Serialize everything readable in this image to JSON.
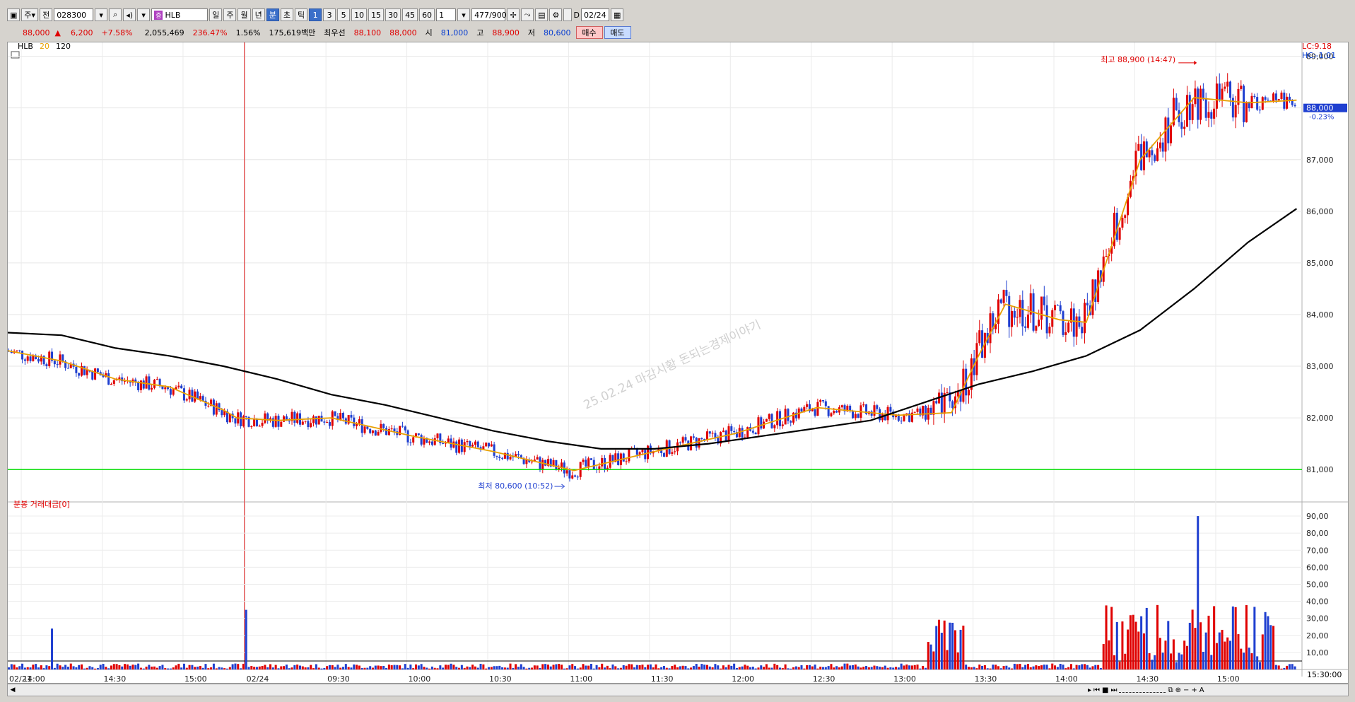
{
  "toolbar": {
    "type_label": "주",
    "ref_label": "전",
    "code": "028300",
    "stock_badge": "증",
    "stock_name": "HLB",
    "periods": [
      "일",
      "주",
      "월",
      "년",
      "분",
      "초",
      "틱"
    ],
    "intervals": [
      "1",
      "3",
      "5",
      "10",
      "15",
      "30",
      "45",
      "60"
    ],
    "count": "1",
    "bars": "477",
    "bars_max": "/900",
    "date": "02/24"
  },
  "quote": {
    "price": "88,000",
    "change_arrow": "▲",
    "change": "6,200",
    "change_pct": "+7.58%",
    "volume": "2,055,469",
    "volume_ratio": "236.47%",
    "turnover": "1.56%",
    "amount": "175,619백만",
    "best_label": "최우선",
    "ask": "88,100",
    "bid": "88,000",
    "open_label": "시",
    "open": "81,000",
    "high_label": "고",
    "high": "88,900",
    "low_label": "저",
    "low": "80,600",
    "buy_label": "매수",
    "sell_label": "매도"
  },
  "chart_legend": {
    "name": "HLB",
    "ma_short": "20",
    "ma_long": "120",
    "lc": "LC:9.18",
    "hc": "HC:-1.01"
  },
  "price_axis": {
    "current": "88,000",
    "current_pct": "-0.23%"
  },
  "annotations": {
    "high": "최고 88,900 (14:47)",
    "low": "최저 80,600 (10:52)",
    "watermark": "25.02.24 마감시황 돈되는경제이야기"
  },
  "volume_legend": "분봉 거래대금[0]",
  "time_axis_end": "15:30:00",
  "colors": {
    "up": "#e00000",
    "down": "#1f3fd0",
    "ma20": "#e8a000",
    "ma120": "#000000",
    "support": "#00dd00",
    "day_divider": "#e02020"
  },
  "chart_data": [
    {
      "type": "candlestick",
      "title": "HLB",
      "ylim": [
        80400,
        89200
      ],
      "yticks": [
        "89,000",
        "88,000",
        "87,000",
        "86,000",
        "85,000",
        "84,000",
        "83,000",
        "82,000",
        "81,000"
      ],
      "ytick_values": [
        89000,
        88000,
        87000,
        86000,
        85000,
        84000,
        83000,
        82000,
        81000
      ],
      "xticks": [
        "02/21",
        "14:00",
        "14:30",
        "15:00",
        "02/24",
        "09:30",
        "10:00",
        "10:30",
        "11:00",
        "11:30",
        "12:00",
        "12:30",
        "13:00",
        "13:30",
        "14:00",
        "14:30",
        "15:00"
      ],
      "xtick_minutes": [
        0,
        5,
        35,
        65,
        88,
        118,
        148,
        178,
        208,
        238,
        268,
        298,
        328,
        358,
        388,
        418,
        448
      ],
      "total_minutes": 480,
      "support_line": 81000,
      "series": [
        {
          "name": "20",
          "minutes": [
            0,
            20,
            40,
            60,
            80,
            85,
            100,
            120,
            150,
            180,
            210,
            240,
            270,
            300,
            330,
            350,
            360,
            370,
            390,
            400,
            420,
            440,
            460,
            478
          ],
          "values": [
            83300,
            83100,
            82750,
            82600,
            82150,
            82000,
            81950,
            82000,
            81650,
            81350,
            80980,
            81350,
            81700,
            82200,
            82050,
            82100,
            83200,
            84200,
            83900,
            83850,
            87000,
            88200,
            88100,
            88150
          ]
        },
        {
          "name": "120",
          "minutes": [
            0,
            20,
            40,
            60,
            80,
            100,
            120,
            140,
            160,
            180,
            200,
            220,
            240,
            260,
            280,
            300,
            320,
            340,
            360,
            380,
            400,
            420,
            440,
            460,
            478
          ],
          "values": [
            83650,
            83600,
            83350,
            83200,
            83000,
            82750,
            82450,
            82250,
            82000,
            81750,
            81550,
            81400,
            81400,
            81500,
            81650,
            81800,
            81950,
            82300,
            82650,
            82900,
            83200,
            83700,
            84500,
            85400,
            86050
          ]
        }
      ],
      "annotations": [
        {
          "label": "최고 88,900 (14:47)",
          "minute": 441,
          "value": 88900
        },
        {
          "label": "최저 80,600 (10:52)",
          "minute": 208,
          "value": 80600
        }
      ]
    },
    {
      "type": "bar",
      "title": "분봉 거래대금[0]",
      "ylim": [
        0,
        95
      ],
      "yticks": [
        "90,00",
        "80,00",
        "70,00",
        "60,00",
        "50,00",
        "40,00",
        "30,00",
        "20,00",
        "10,00"
      ],
      "ytick_values": [
        90,
        80,
        70,
        60,
        50,
        40,
        30,
        20,
        10
      ]
    }
  ]
}
